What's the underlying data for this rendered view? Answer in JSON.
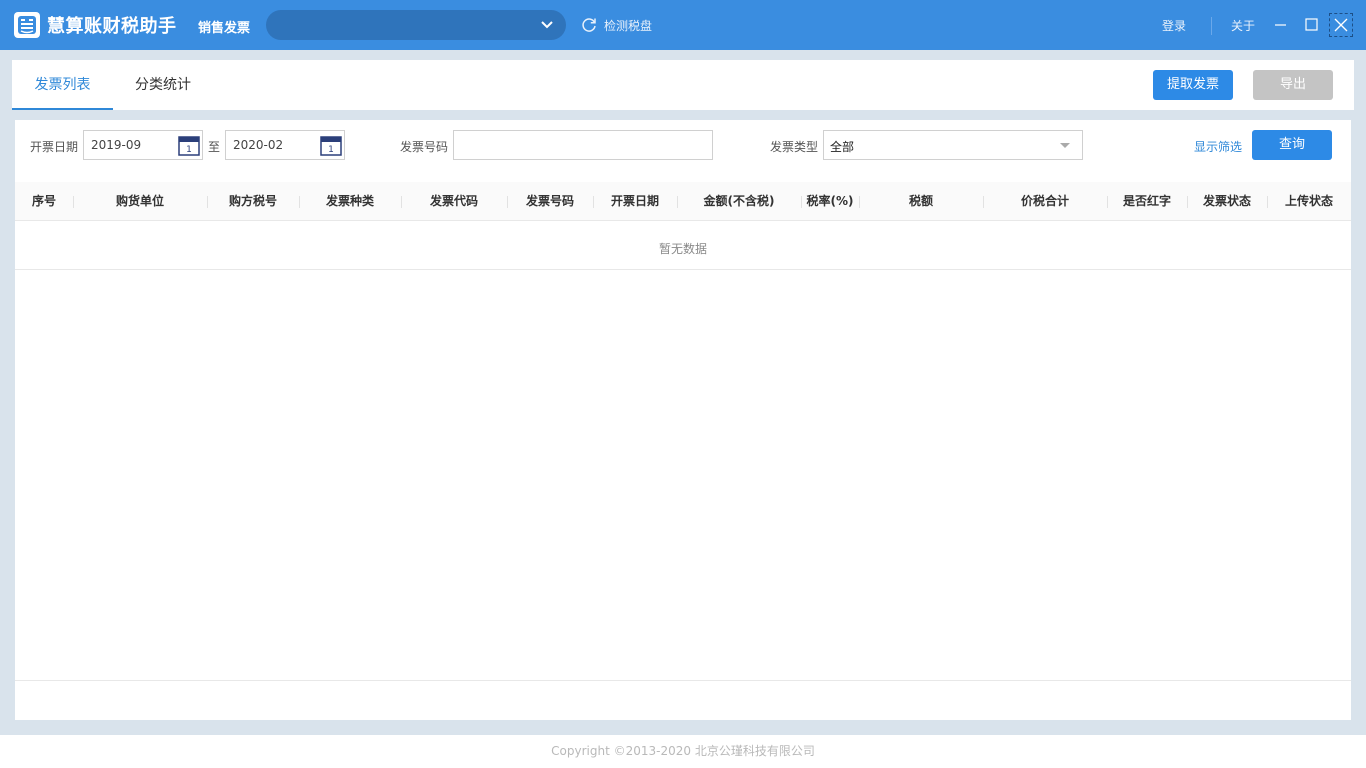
{
  "titlebar": {
    "app_title": "慧算账财税助手",
    "module_title": "销售发票",
    "company_selected": "",
    "detect_label": "检测税盘",
    "login_label": "登录",
    "about_label": "关于"
  },
  "tabs": [
    {
      "label": "发票列表",
      "active": true
    },
    {
      "label": "分类统计",
      "active": false
    }
  ],
  "actions": {
    "fetch_label": "提取发票",
    "export_label": "导出"
  },
  "filters": {
    "date_label": "开票日期",
    "date_from": "2019-09",
    "date_to_sep": "至",
    "date_to": "2020-02",
    "invoice_no_label": "发票号码",
    "invoice_no_value": "",
    "invoice_type_label": "发票类型",
    "invoice_type_value": "全部",
    "show_filter_label": "显示筛选",
    "query_label": "查询",
    "calendar_day": "1"
  },
  "table": {
    "columns": [
      "序号",
      "购货单位",
      "购方税号",
      "发票种类",
      "发票代码",
      "发票号码",
      "开票日期",
      "金额(不含税)",
      "税率(%)",
      "税额",
      "价税合计",
      "是否红字",
      "发票状态",
      "上传状态"
    ],
    "rows": [],
    "empty_text": "暂无数据"
  },
  "footer": {
    "copyright": "Copyright ©2013-2020 北京公瑾科技有限公司"
  },
  "colors": {
    "titlebar": "#3a8de0",
    "accent": "#2d8ae6",
    "disabled": "#c4c4c4"
  }
}
